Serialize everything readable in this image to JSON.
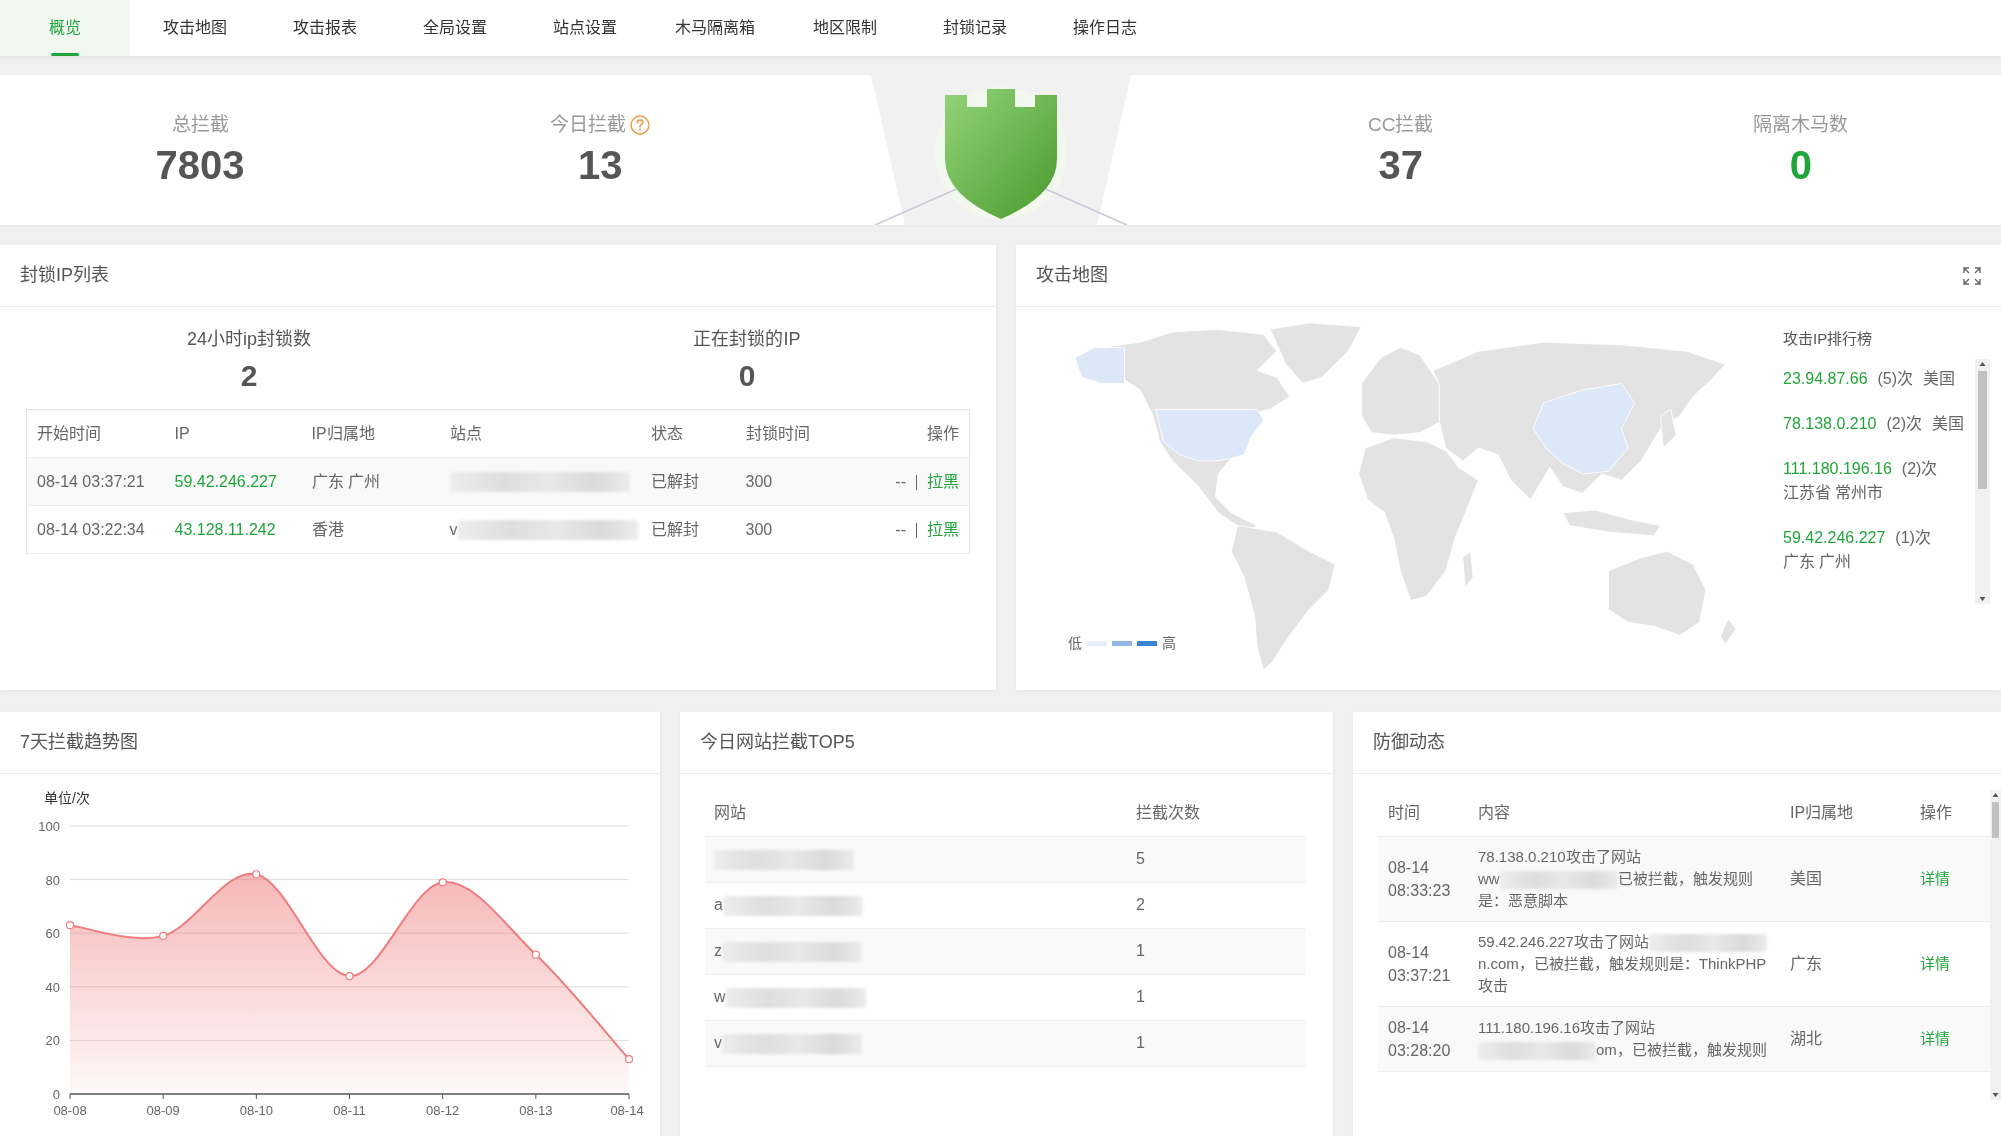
{
  "tabs": [
    {
      "label": "概览",
      "selected": true
    },
    {
      "label": "攻击地图",
      "selected": false
    },
    {
      "label": "攻击报表",
      "selected": false
    },
    {
      "label": "全局设置",
      "selected": false
    },
    {
      "label": "站点设置",
      "selected": false
    },
    {
      "label": "木马隔离箱",
      "selected": false
    },
    {
      "label": "地区限制",
      "selected": false
    },
    {
      "label": "封锁记录",
      "selected": false
    },
    {
      "label": "操作日志",
      "selected": false
    }
  ],
  "stats": [
    {
      "label": "总拦截",
      "value": "7803",
      "help": false,
      "color": "#555555"
    },
    {
      "label": "今日拦截",
      "value": "13",
      "help": true,
      "color": "#555555"
    },
    {
      "label": "CC拦截",
      "value": "37",
      "help": false,
      "color": "#555555"
    },
    {
      "label": "隔离木马数",
      "value": "0",
      "help": false,
      "color": "#20a53a"
    }
  ],
  "blocked_ips": {
    "title": "封锁IP列表",
    "summary": [
      {
        "label": "24小时ip封锁数",
        "value": "2"
      },
      {
        "label": "正在封锁的IP",
        "value": "0"
      }
    ],
    "columns": [
      "开始时间",
      "IP",
      "IP归属地",
      "站点",
      "状态",
      "封锁时间",
      "操作"
    ],
    "rows": [
      {
        "start_time": "08-14 03:37:21",
        "ip": "59.42.246.227",
        "location": "广东 广州",
        "site": {
          "redacted": true
        },
        "status": "已解封",
        "duration": "300",
        "unblock": "--",
        "action": "拉黑"
      },
      {
        "start_time": "08-14 03:22:34",
        "ip": "43.128.11.242",
        "location": "香港",
        "site": {
          "prefix": "v",
          "redacted": true
        },
        "status": "已解封",
        "duration": "300",
        "unblock": "--",
        "action": "拉黑"
      }
    ]
  },
  "attack_map": {
    "title": "攻击地图",
    "legend": {
      "low": "低",
      "high": "高",
      "swatches": [
        {
          "color": "#e4edf9"
        },
        {
          "color": "#92b7e5"
        },
        {
          "color": "#3c84d8"
        }
      ]
    },
    "ranking": {
      "title": "攻击IP排行榜",
      "items": [
        {
          "ip": "23.94.87.66",
          "count": "(5)次",
          "location": "美国"
        },
        {
          "ip": "78.138.0.210",
          "count": "(2)次",
          "location": "美国"
        },
        {
          "ip": "111.180.196.16",
          "count": "(2)次",
          "location": "江苏省 常州市"
        },
        {
          "ip": "59.42.246.227",
          "count": "(1)次",
          "location": "广东 广州"
        }
      ]
    }
  },
  "trend": {
    "title": "7天拦截趋势图",
    "chart_data": {
      "type": "area",
      "ylabel": "单位/次",
      "categories": [
        "08-08",
        "08-09",
        "08-10",
        "08-11",
        "08-12",
        "08-13",
        "08-14"
      ],
      "series": [
        {
          "color": "#ef7d7d",
          "values": [
            63,
            59,
            82,
            44,
            79,
            52,
            13
          ]
        }
      ],
      "ylim": [
        0,
        100
      ],
      "yticks": [
        0,
        20,
        40,
        60,
        80,
        100
      ],
      "grid": true
    }
  },
  "top_sites": {
    "title": "今日网站拦截TOP5",
    "columns": [
      "网站",
      "拦截次数"
    ],
    "rows": [
      {
        "site": {
          "redacted": true
        },
        "count": "5"
      },
      {
        "site": {
          "prefix": "a",
          "redacted": true
        },
        "count": "2"
      },
      {
        "site": {
          "prefix": "z",
          "redacted": true
        },
        "count": "1"
      },
      {
        "site": {
          "prefix": "w",
          "redacted": true
        },
        "count": "1"
      },
      {
        "site": {
          "prefix": "v",
          "redacted": true
        },
        "count": "1"
      }
    ]
  },
  "defense": {
    "title": "防御动态",
    "columns": [
      "时间",
      "内容",
      "IP归属地",
      "操作"
    ],
    "rows": [
      {
        "time": "08-14 08:33:23",
        "content": [
          {
            "kind": "text",
            "text": "78.138.0.210攻击了网站"
          },
          {
            "kind": "redacted",
            "prefix": "ww"
          },
          {
            "kind": "text",
            "text": "已被拦截，触发规则是：恶意脚本"
          }
        ],
        "location": "美国",
        "action": "详情"
      },
      {
        "time": "08-14 03:37:21",
        "content": [
          {
            "kind": "text",
            "text": "59.42.246.227攻击了网站"
          },
          {
            "kind": "redacted"
          },
          {
            "kind": "text",
            "text": "n.com，已被拦截，触发规则是：ThinkPHP攻击"
          }
        ],
        "location": "广东",
        "action": "详情"
      },
      {
        "time": "08-14 03:28:20",
        "content": [
          {
            "kind": "text",
            "text": "111.180.196.16攻击了网站"
          },
          {
            "kind": "redacted"
          },
          {
            "kind": "text",
            "text": "om，已被拦截，触发规则"
          }
        ],
        "location": "湖北",
        "action": "详情"
      }
    ]
  }
}
